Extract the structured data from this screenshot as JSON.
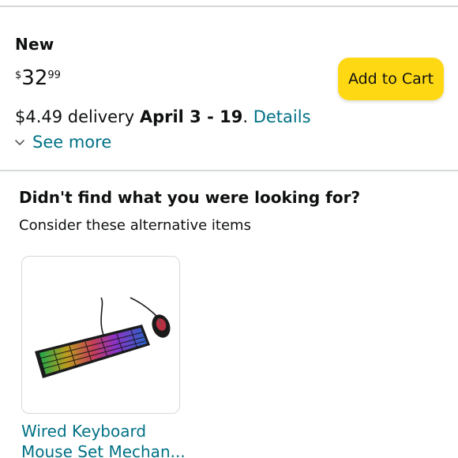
{
  "offer": {
    "condition": "New",
    "price": {
      "symbol": "$",
      "whole": "32",
      "fraction": "99"
    },
    "add_to_cart_label": "Add to Cart",
    "delivery": {
      "prefix": "$4.49 delivery ",
      "date": "April 3 - 19",
      "separator": ". ",
      "details_link": "Details"
    },
    "see_more_label": "See more"
  },
  "alternatives": {
    "title": "Didn't find what you were looking for?",
    "subtitle": "Consider these alternative items",
    "items": [
      {
        "title_line1": "Wired Keyboard",
        "title_line2": "Mouse Set Mechan...",
        "image": "keyboard-mouse-rgb-image"
      }
    ]
  },
  "colors": {
    "button_yellow": "#ffd814",
    "link_teal": "#007185",
    "text": "#0f1111",
    "divider": "#d5d9d9"
  }
}
